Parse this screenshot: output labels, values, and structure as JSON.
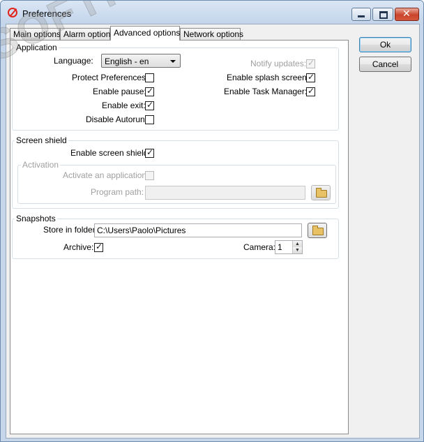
{
  "window": {
    "title": "Preferences",
    "icon": "no-entry-icon"
  },
  "tabs": [
    {
      "label": "Main options",
      "active": false
    },
    {
      "label": "Alarm options",
      "active": false
    },
    {
      "label": "Advanced options",
      "active": true
    },
    {
      "label": "Network options",
      "active": false
    }
  ],
  "dialog_buttons": {
    "ok": "Ok",
    "cancel": "Cancel"
  },
  "application": {
    "group_label": "Application",
    "language_label": "Language:",
    "language_value": "English - en",
    "protect_label": "Protect Preferences:",
    "protect_checked": false,
    "pause_label": "Enable pause:",
    "pause_checked": true,
    "exit_label": "Enable exit:",
    "exit_checked": true,
    "autorun_label": "Disable Autorun:",
    "autorun_checked": false,
    "notify_label": "Notify updates:",
    "notify_checked": true,
    "notify_enabled": false,
    "splash_label": "Enable splash screen:",
    "splash_checked": true,
    "taskmgr_label": "Enable Task Manager:",
    "taskmgr_checked": true
  },
  "screen_shield": {
    "group_label": "Screen shield",
    "enable_label": "Enable screen shield:",
    "enable_checked": true,
    "activation": {
      "group_label": "Activation",
      "activate_label": "Activate an application:",
      "activate_checked": false,
      "path_label": "Program path:",
      "path_value": ""
    }
  },
  "snapshots": {
    "group_label": "Snapshots",
    "folder_label": "Store in folder:",
    "folder_value": "C:\\Users\\Paolo\\Pictures",
    "archive_label": "Archive:",
    "archive_checked": true,
    "camera_label": "Camera:",
    "camera_value": "1"
  },
  "check_glyph": "✓",
  "spin_up_glyph": "▲",
  "spin_down_glyph": "▼",
  "watermark": "SOFTPORTAL"
}
